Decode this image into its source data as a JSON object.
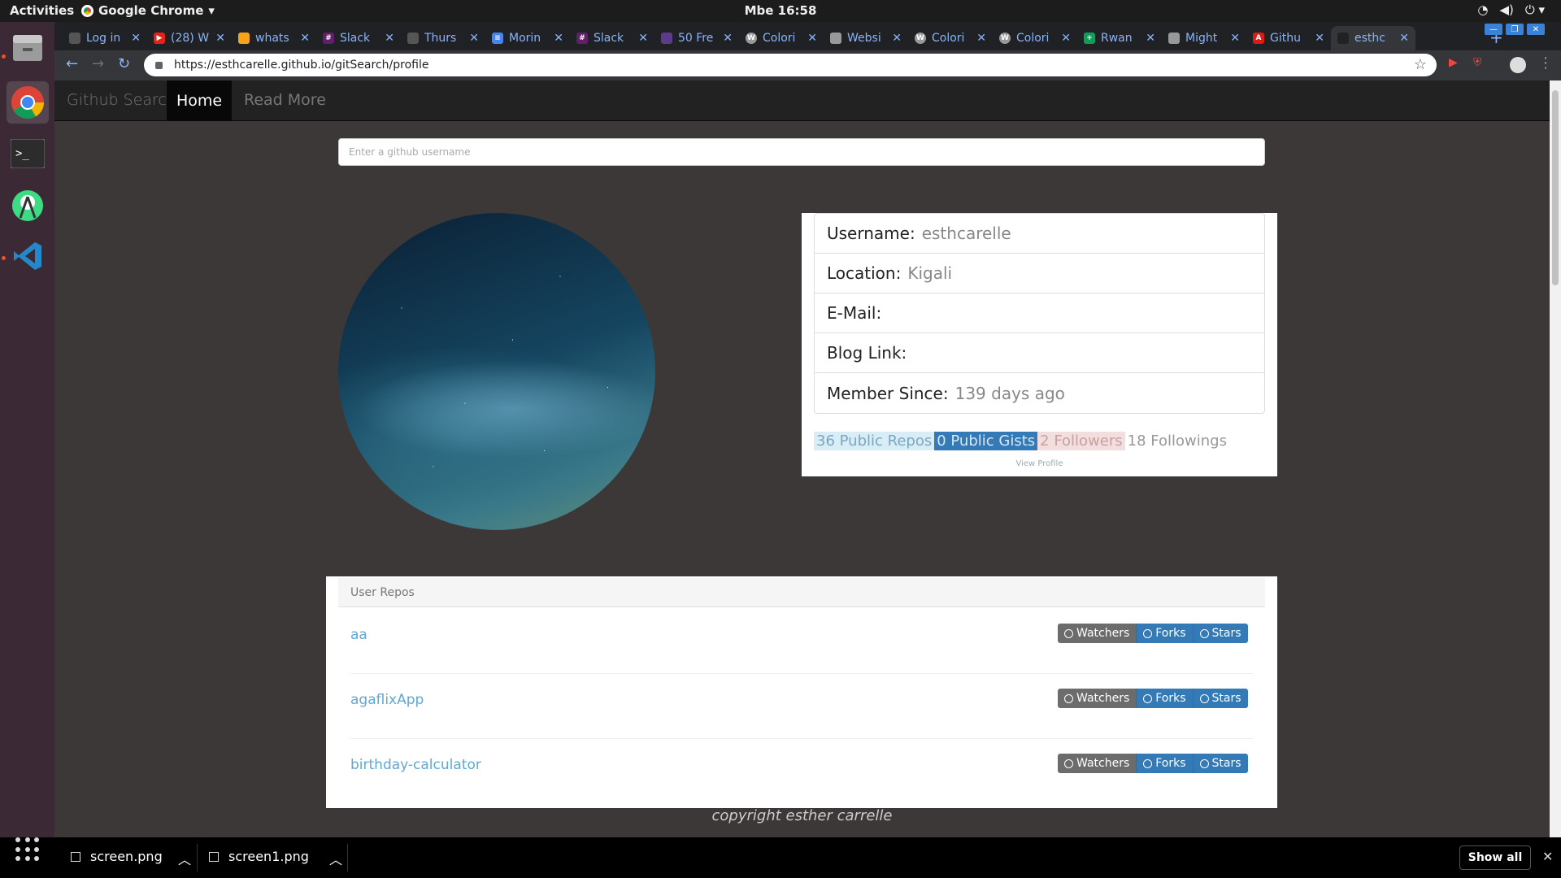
{
  "topbar": {
    "activities": "Activities",
    "app_name": "Google Chrome",
    "app_menu_arrow": "▾",
    "clock": "Mbe 16:58",
    "icons": [
      "wifi-icon",
      "volume-icon",
      "power-icon"
    ]
  },
  "dock": {
    "items": [
      "files",
      "chrome",
      "terminal",
      "android-studio",
      "vscode"
    ]
  },
  "tabs": [
    {
      "label": "Log in",
      "color": "#555"
    },
    {
      "label": "(28) W",
      "color": "#e62117"
    },
    {
      "label": "whats",
      "color": "#f7a21b"
    },
    {
      "label": "Slack",
      "color": "#611f69"
    },
    {
      "label": "Thurs",
      "color": "#555"
    },
    {
      "label": "Morin",
      "color": "#4285f4"
    },
    {
      "label": "Slack",
      "color": "#611f69"
    },
    {
      "label": "50 Fre",
      "color": "#5c3b8c"
    },
    {
      "label": "Colori",
      "color": "#999"
    },
    {
      "label": "Websi",
      "color": "#999"
    },
    {
      "label": "Colori",
      "color": "#999"
    },
    {
      "label": "Colori",
      "color": "#999"
    },
    {
      "label": "Rwan",
      "color": "#0f9d58"
    },
    {
      "label": "Might",
      "color": "#999"
    },
    {
      "label": "Githu",
      "color": "#dd1b16"
    },
    {
      "label": "esthc",
      "color": "#222"
    }
  ],
  "omnibox": {
    "url": "https://esthcarelle.github.io/gitSearch/profile"
  },
  "site": {
    "brand": "Github Search",
    "nav_home": "Home",
    "nav_more": "Read More",
    "search_placeholder": "Enter a github username"
  },
  "profile": {
    "fields": [
      {
        "label": "Username:",
        "value": "esthcarelle"
      },
      {
        "label": "Location:",
        "value": "Kigali"
      },
      {
        "label": "E-Mail:",
        "value": ""
      },
      {
        "label": "Blog Link:",
        "value": ""
      },
      {
        "label": "Member Since:",
        "value": "139 days ago"
      }
    ],
    "stats": {
      "repos": "36 Public Repos",
      "gists": "0 Public Gists",
      "followers": "2 Followers",
      "following": "18 Followings"
    },
    "view_profile": "View Profile"
  },
  "repos": {
    "heading": "User Repos",
    "items": [
      {
        "name": "aa",
        "watchers": "Watchers",
        "forks": "Forks",
        "stars": "Stars"
      },
      {
        "name": "agaflixApp",
        "watchers": "Watchers",
        "forks": "Forks",
        "stars": "Stars"
      },
      {
        "name": "birthday-calculator",
        "watchers": "Watchers",
        "forks": "Forks",
        "stars": "Stars"
      }
    ]
  },
  "footer": {
    "copyright": "copyright esther carrelle"
  },
  "downloads": {
    "items": [
      "screen.png",
      "screen1.png"
    ],
    "show_all": "Show all"
  }
}
